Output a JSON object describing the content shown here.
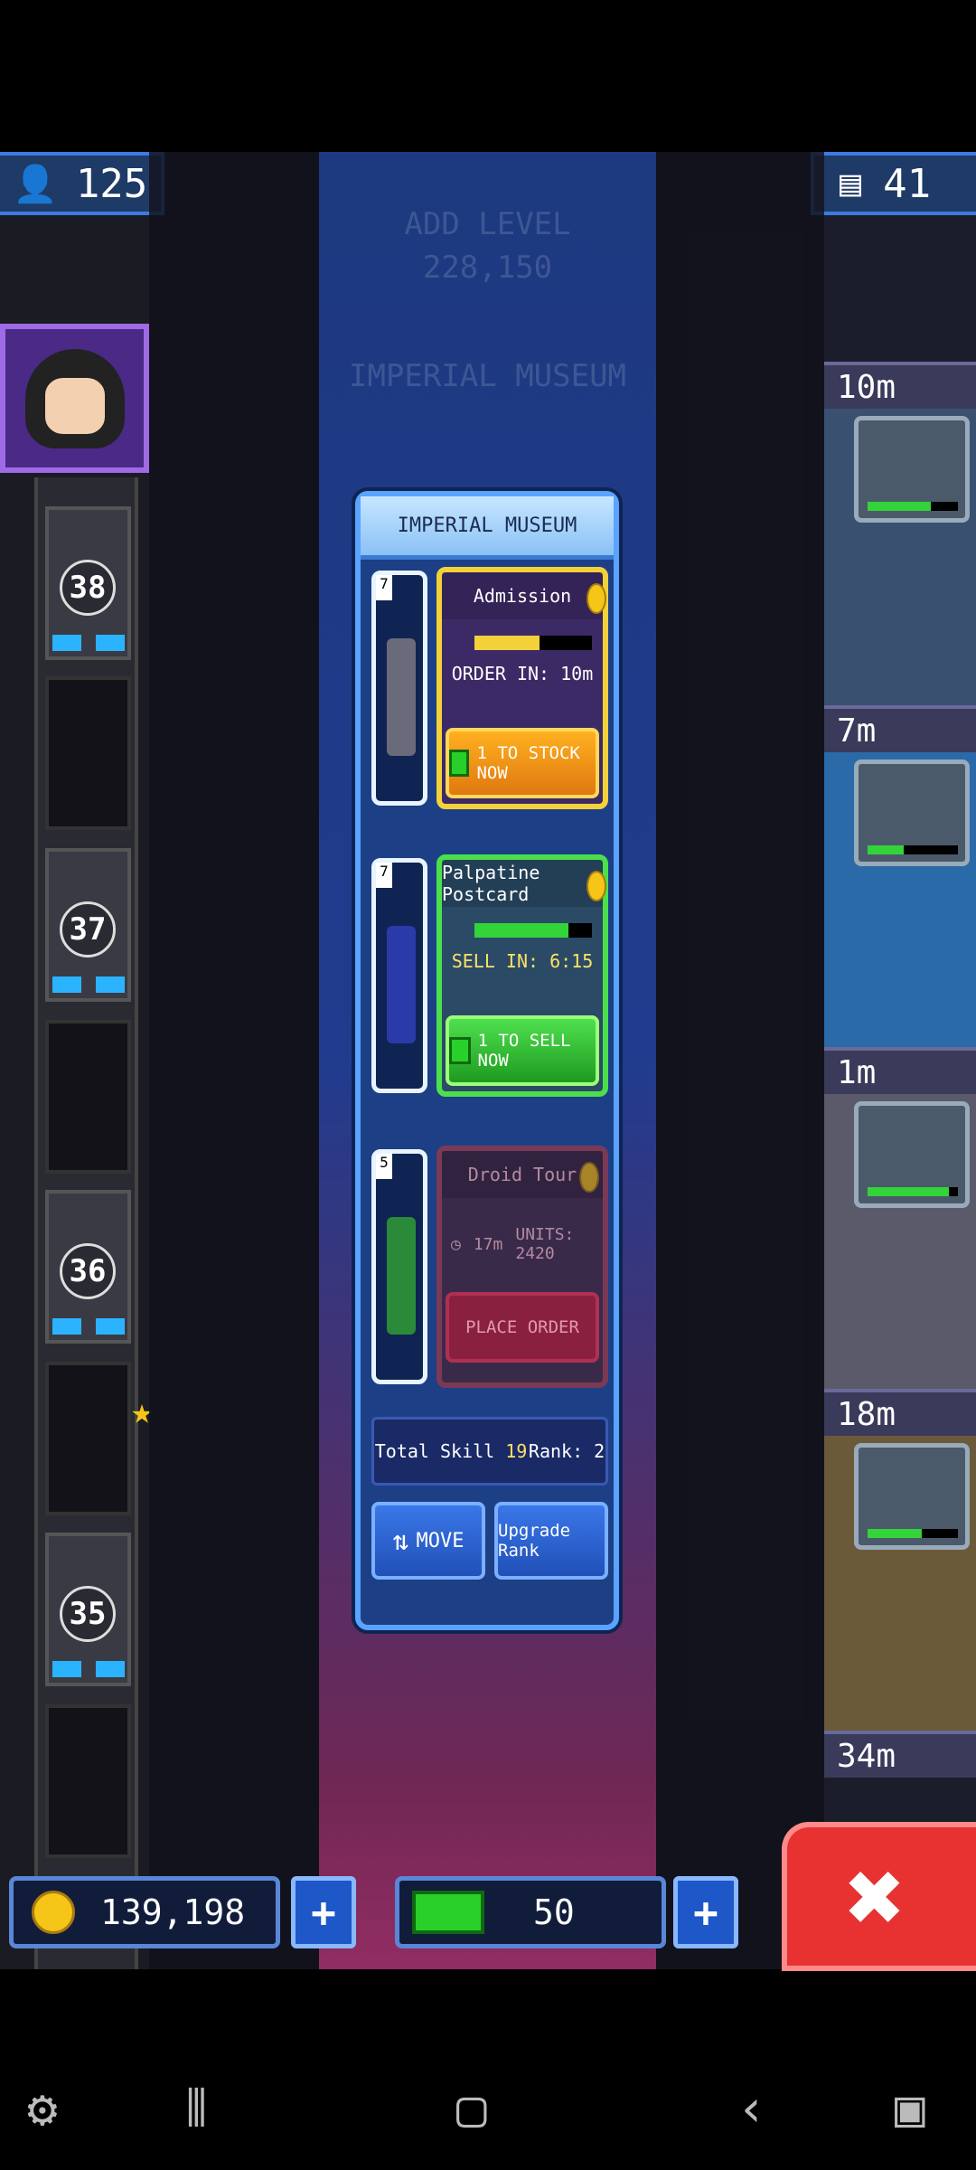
{
  "hud": {
    "population": "125",
    "floors": "41"
  },
  "ghost": {
    "add_level": "ADD LEVEL",
    "add_level_cost": "228,150",
    "floor_name": "IMPERIAL MUSEUM"
  },
  "elevator": {
    "floors": [
      "38",
      "37",
      "36",
      "35"
    ]
  },
  "right_sidebar": {
    "timers": [
      "10m",
      "7m",
      "1m",
      "18m",
      "34m"
    ]
  },
  "modal": {
    "title": "IMPERIAL MUSEUM",
    "slots": [
      {
        "level": "7",
        "name": "Admission",
        "status": "ORDER IN: 10m",
        "button": "1 TO STOCK NOW",
        "progress": 0.55
      },
      {
        "level": "7",
        "name": "Palpatine Postcard",
        "status": "SELL IN: 6:15",
        "button": "1 TO SELL NOW",
        "progress": 0.8
      },
      {
        "level": "5",
        "name": "Droid Tour",
        "time": "17m",
        "units": "UNITS: 2420",
        "button": "PLACE ORDER"
      }
    ],
    "stats": {
      "total_skill_label": "Total Skill",
      "total_skill_value": "19",
      "rank_label": "Rank:",
      "rank_value": "2"
    },
    "move_label": "MOVE",
    "upgrade_label": "Upgrade Rank"
  },
  "currency": {
    "coins": "139,198",
    "bux": "50"
  },
  "colors": {
    "accent_blue": "#5aa3ff",
    "gold": "#f2d13a",
    "green": "#4be04b",
    "close_red": "#e83232"
  }
}
